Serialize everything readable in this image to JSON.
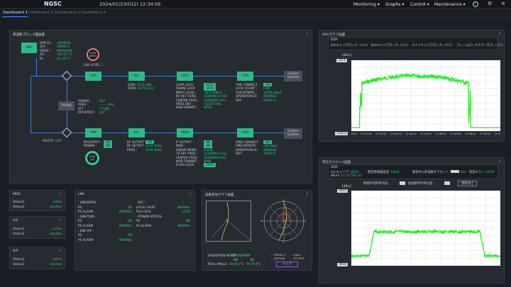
{
  "app": {
    "title": "NGSC",
    "clock": "2024/01/23(012) 12:34:56"
  },
  "menu": [
    {
      "label": "Monitoring"
    },
    {
      "label": "Graphs"
    },
    {
      "label": "Control"
    },
    {
      "label": "Maintenance"
    }
  ],
  "tabs": [
    "Dashboard 1",
    "Dashboard 2",
    "Dashboard 3",
    "Dashboard 4"
  ],
  "block": {
    "title": "周波数ブロック図画面",
    "ant": {
      "label": "ANT",
      "keys": [
        "OPR ID :",
        "SAT :",
        "DRIVE :",
        "AZ :",
        "EL :"
      ],
      "vals": [
        "-0000001",
        "20000-5",
        "PROGRAM",
        "130.02 [°]",
        "32.43 [°]"
      ]
    },
    "lna_level": {
      "value": "0.00",
      "unit": "[dBm]",
      "label": "LNA LEVEL",
      "num": "1"
    },
    "lna": "LNA",
    "dc": "D/C",
    "dem": "DEM",
    "tlm": "TLM",
    "center1": "Center System",
    "center2": "Center System",
    "trans": "TRANS",
    "amp": "AMP",
    "uc": "U/C",
    "mod": "MOD",
    "cmd": "CMD",
    "dc_kv": {
      "keys": [
        "GAIN :",
        "FERQ :"
      ],
      "vals": [
        "60.0 [dB]",
        "1270 [kHz]"
      ]
    },
    "dem_kv": {
      "keys": [
        "CARR LOCK",
        "FRAME LOCK",
        "INPUT LEVEL :",
        "RX REF FERQ :",
        "CENTER FREQ :",
        "FREQ DEV :",
        "DEM FORMAT :"
      ],
      "vals": [
        "-40.0 [dBm]",
        "1234000.0 [Hz]",
        "34500000 [Hz]",
        "-12345 [Hz]",
        "QPSK"
      ],
      "tags": [
        "LOCK",
        "LOCK"
      ]
    },
    "tlm_kv": {
      "keys": [
        "TLM CONNECT :",
        "LOCK COUNT :",
        "TLM BITRATE :",
        "OPERATION ID :",
        "SAT :"
      ],
      "vals": [
        "0.00",
        "12345 [bps]",
        "2000002",
        "20000-5"
      ],
      "tag": "ON"
    },
    "trans_kv": {
      "keys": [
        "POWER :",
        "FREQ :",
        "ATT :",
        "RFOUTPUT :"
      ],
      "vals": [
        "OFF",
        "------- [Hz]",
        "** [dB]",
        "OFF"
      ]
    },
    "amp_kv": {
      "keys": [
        "RFOUTPUT :",
        "POWER :"
      ],
      "tags": [
        "ON",
        "ON"
      ]
    },
    "uc_kv": {
      "keys": [
        "RF OUTPUT :",
        "RF OUTPUT :",
        "FERQ :"
      ],
      "vals": [
        "1234 [kHz]",
        "1234 [kHz]"
      ],
      "tag": "ON"
    },
    "mod_kv": {
      "keys": [
        "IF OUTPUT :",
        "MOD :",
        "SWEEP MODE :",
        "TX REF FREQ :",
        "CENTER FREQ :",
        "MOD FORMAT :",
        "ECHO LOCK :"
      ],
      "vals": [
        "CLOSE",
        "1234000.0 [Hz]",
        "34500000 [Hz]",
        "BPSK"
      ],
      "tags": [
        "ON",
        "ON",
        "LOCK"
      ]
    },
    "cmd_kv": {
      "keys": [
        "CMD CONNECT :",
        "CMD BITRATE :",
        "OPERATION ID :",
        "SAT :"
      ],
      "vals": [
        "240 [bps]",
        "2000002",
        "20000-5"
      ],
      "tag": "ON"
    },
    "power_gauge": {
      "value": "0.00",
      "unit": "[W]"
    },
    "route": "ROUTE:",
    "route_val": "LINT"
  },
  "agc": {
    "title": "AGCグラフ画面",
    "dem": "DEM",
    "locks": [
      {
        "k": "4chキャリアロック:",
        "v": "LOCK"
      },
      {
        "k": "8chキャリアロック:",
        "v": "LOCK"
      },
      {
        "k": "メインキャリアロック:",
        "v": "LOCK"
      },
      {
        "k": "フレームロックステータス:",
        "v": "LOCK"
      }
    ],
    "unit": "[dBm]",
    "ytop": "-50.0",
    "ybot": "-150.0",
    "yticks": [
      "-60",
      "-70",
      "-80",
      "-90",
      "-100",
      "-110",
      "-120",
      "-130",
      "-140"
    ],
    "xticks": [
      "07:40:00",
      "07:41:00",
      "07:42:00",
      "07:43:00",
      "07:44:00",
      "07:45:00",
      "07:46:00",
      "07:47:00",
      "07:48:00",
      "07:49:00",
      "07:50:00"
    ]
  },
  "spec": {
    "title": "受信スペクトル画面",
    "dem": "DEM",
    "r1": [
      {
        "k": "4chキャリア:",
        "v": "LOCK"
      },
      {
        "k": "雑音帯域幅設定:",
        "v": "LOCK"
      },
      {
        "k": "雑音中心周波数オフセット:",
        "v": "kHz"
      },
      {
        "k": "時刻エラー:",
        "v": "LOCK"
      }
    ],
    "r2": "MEAS",
    "r2v": "3/1 55:561.67",
    "ctrl": [
      "時間平均時平均化:",
      "周波数平均平均化:"
    ],
    "btn": "更新停止",
    "unit": "[dBm]",
    "ytop": "-40.0",
    "ybot": "-90.0",
    "yticks": [
      "-45.0",
      "-50.0",
      "-55.0",
      "-60.0",
      "-65.0",
      "-70.0",
      "-75.0",
      "-80.0",
      "-85.0"
    ]
  },
  "mod_p": {
    "title": "MOD",
    "rows": [
      {
        "k": "Status1",
        "v": "active"
      },
      {
        "k": "Status2",
        "v": "inactive"
      }
    ]
  },
  "uc_p": {
    "title": "U/C",
    "rows": [
      {
        "k": "Status1",
        "v": "active"
      },
      {
        "k": "Status2",
        "v": "inactive"
      }
    ]
  },
  "dc_p": {
    "title": "D/C",
    "rows": [
      {
        "k": "Status1",
        "v": "active"
      },
      {
        "k": "Status2",
        "v": "inactive"
      }
    ]
  },
  "lna_p": {
    "title": "LNA",
    "left": [
      {
        "h": "- LNA(DATA) -"
      },
      {
        "k": "PS",
        "v": "ON"
      },
      {
        "k": "PS ALARM",
        "v": "NORMAL"
      },
      {
        "h": "- LNA(TLM) -"
      },
      {
        "k": "PS",
        "v": "ON"
      },
      {
        "k": "PS ALARM",
        "v": "NORMAL"
      },
      {
        "h": "- LNA P/S -"
      },
      {
        "k": "PS",
        "v": "ON"
      },
      {
        "k": "PS ALARM",
        "v": "NORMAL"
      }
    ],
    "right": [
      {
        "h": "- D/C -"
      },
      {
        "k": "LOCAL FAULT",
        "v": "NORMAL"
      },
      {
        "k": "PLO LOCK",
        "v": "LOCK"
      },
      {
        "h": "- POWER STATUS -"
      },
      {
        "k": "PS",
        "v": "ON"
      },
      {
        "k": "PS ALARM",
        "v": "NORMAL"
      }
    ]
  },
  "track": {
    "title": "追尾状況グラフ画面",
    "op_k": "OPERATION MODE",
    "op_v": "PROGRAM",
    "az": "AZ",
    "el": "EL",
    "real": "REAL ANGLE",
    "az_v": "90.00",
    "el_v": "90.00",
    "deg": "[°]",
    "legend": [
      "PREDICT",
      "REAL",
      "SKYLINE",
      "RF-TRIP"
    ],
    "btn": "クリア",
    "compass": [
      "N",
      "E",
      "S",
      "W"
    ]
  }
}
